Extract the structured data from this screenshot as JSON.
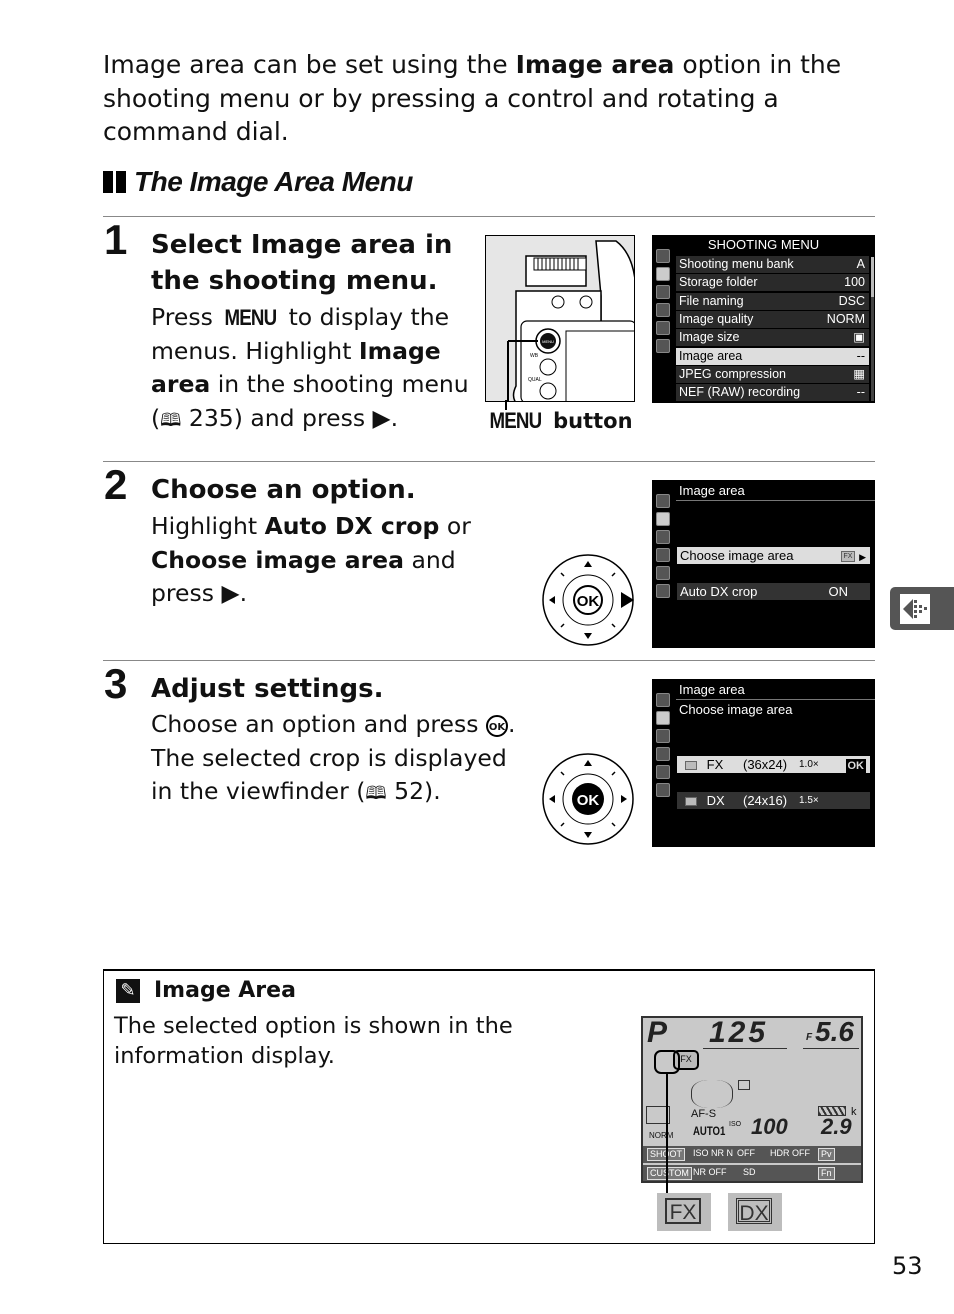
{
  "intro": {
    "part1": "Image area can be set using the ",
    "bold1": "Image area",
    "part2": " option in the shooting menu or by pressing a control and rotating a command dial."
  },
  "section_title": "The Image Area Menu",
  "steps": [
    {
      "number": "1",
      "heading_pre": "Select ",
      "heading_bold": "Image area",
      "heading_post": " in the shooting menu.",
      "body_pre": "Press ",
      "body_menu": "MENU",
      "body_mid": " to display the menus.  Highlight ",
      "body_bold": "Image area",
      "body_mid2": " in the shooting menu (",
      "body_ref_icon": "book-icon",
      "body_ref": " 235) and press ",
      "body_arrow": "▶",
      "body_end": ".",
      "illustration_label_menu": "MENU",
      "illustration_label": " button"
    },
    {
      "number": "2",
      "heading": "Choose an option.",
      "body_pre": "Highlight ",
      "body_bold1": "Auto DX crop",
      "body_mid": " or ",
      "body_bold2": "Choose image area",
      "body_post": " and press ",
      "body_arrow": "▶",
      "body_end": "."
    },
    {
      "number": "3",
      "heading": "Adjust settings.",
      "body_pre": "Choose an option and press ",
      "body_ok": "OK",
      "body_post": ". The selected crop is displayed in the viewfinder (",
      "body_ref": " 52)."
    }
  ],
  "shooting_menu_screen": {
    "title": "SHOOTING MENU",
    "rows": [
      {
        "label": "Shooting menu bank",
        "value": "A"
      },
      {
        "label": "Storage folder",
        "value": "100"
      },
      {
        "label": "File naming",
        "value": "DSC"
      },
      {
        "label": "Image quality",
        "value": "NORM"
      },
      {
        "label": "Image size",
        "value": "▣"
      },
      {
        "label": "Image area",
        "value": "--",
        "selected": true
      },
      {
        "label": "JPEG compression",
        "value": "▦"
      },
      {
        "label": "NEF (RAW) recording",
        "value": "--"
      }
    ]
  },
  "image_area_screen": {
    "title": "Image area",
    "options": [
      {
        "label": "Choose image area",
        "value": "FX",
        "arrow": "▶",
        "selected": true
      },
      {
        "label": "Auto DX crop",
        "value": "ON"
      }
    ]
  },
  "choose_area_screen": {
    "title": "Image area",
    "subtitle": "Choose image area",
    "options": [
      {
        "icon": "FX",
        "label": "FX",
        "size": "(36x24)",
        "crop": "1.0×",
        "ok": "OK",
        "selected": true
      },
      {
        "icon": "DX",
        "label": "DX",
        "size": "(24x16)",
        "crop": "1.5×"
      }
    ]
  },
  "multi_selector": {
    "center": "OK"
  },
  "note": {
    "title": "Image Area",
    "body": "The selected option is shown in the information display."
  },
  "info_display": {
    "mode": "P",
    "shutter": "125",
    "aperture_prefix": "F",
    "aperture": "5.6",
    "image_area": "FX",
    "af_mode": "AF-S",
    "iso_label": "ISO",
    "iso": "100",
    "auto": "AUTO1",
    "quality": "NORM",
    "remaining": "2.9",
    "remaining_unit": "k",
    "bottom_row1": [
      "SHOOT",
      "ISO NR N",
      "OFF",
      "HDR OFF",
      "Pv",
      ""
    ],
    "bottom_row2": [
      "CUSTOM",
      "NR OFF",
      "SD",
      "",
      "",
      "Fn"
    ]
  },
  "symbols": [
    "FX",
    "DX"
  ],
  "page_number": "53",
  "side_tab_icon": "shooting-menu-tab-icon",
  "colors": {
    "text": "#111111",
    "screen_bg": "#000000",
    "highlight": "#dddddd",
    "tab": "#555555",
    "lcd": "#c9c9c9"
  }
}
